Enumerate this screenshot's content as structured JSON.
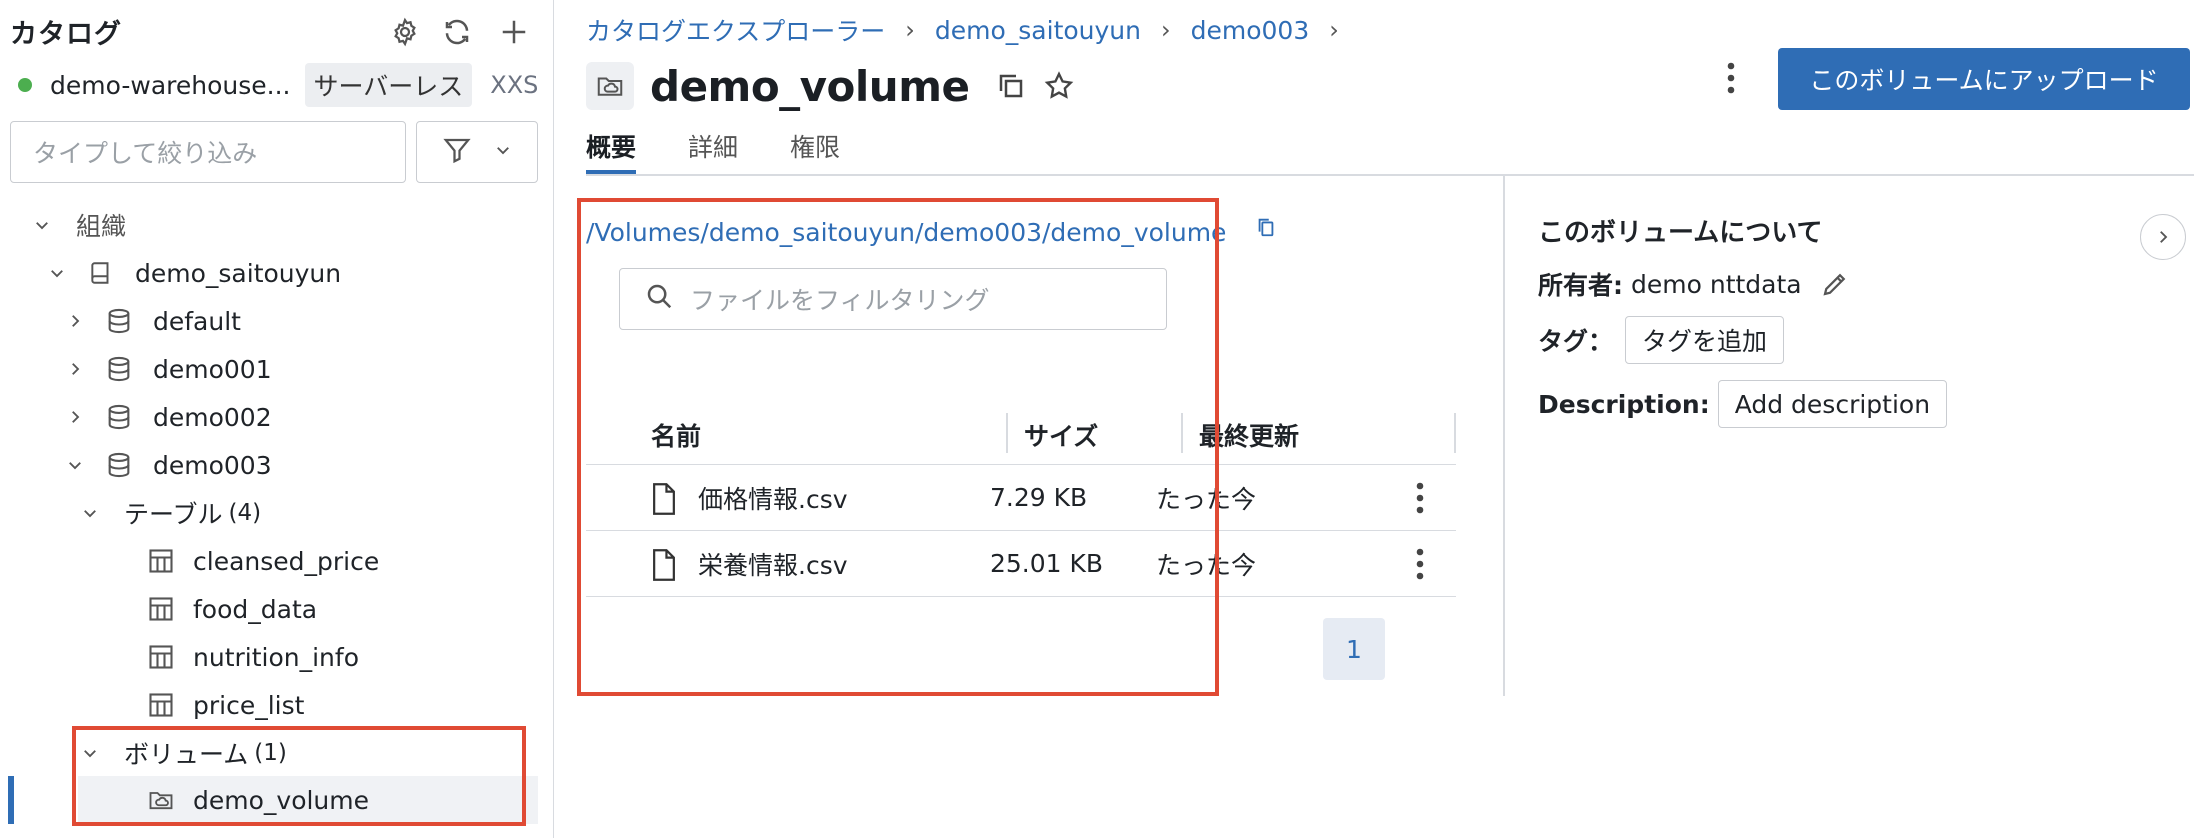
{
  "sidebar": {
    "title": "カタログ",
    "icons": [
      "settings-icon",
      "refresh-icon",
      "plus-icon"
    ],
    "warehouse": {
      "name": "demo-warehouse...",
      "badge": "サーバーレス",
      "size": "XXS",
      "status_color": "#4cae4f"
    },
    "filter_placeholder": "タイプして絞り込み",
    "tree": {
      "org": "組織",
      "catalog": "demo_saitouyun",
      "schemas": [
        "default",
        "demo001",
        "demo002",
        "demo003"
      ],
      "tables_label": "テーブル",
      "tables_count": "(4)",
      "tables": [
        "cleansed_price",
        "food_data",
        "nutrition_info",
        "price_list"
      ],
      "volumes_label": "ボリューム",
      "volumes_count": "(1)",
      "volume": "demo_volume"
    }
  },
  "breadcrumb": {
    "items": [
      "カタログエクスプローラー",
      "demo_saitouyun",
      "demo003"
    ]
  },
  "page": {
    "title": "demo_volume",
    "upload_label": "このボリュームにアップロード",
    "accent": "#2f6db5"
  },
  "tabs": [
    "概要",
    "詳細",
    "権限"
  ],
  "volume_panel": {
    "path": "/Volumes/demo_saitouyun/demo003/demo_volume",
    "filter_placeholder": "ファイルをフィルタリング",
    "columns": {
      "name": "名前",
      "size": "サイズ",
      "modified": "最終更新"
    },
    "rows": [
      {
        "name": "価格情報.csv",
        "size": "7.29 KB",
        "modified": "たった今"
      },
      {
        "name": "栄養情報.csv",
        "size": "25.01 KB",
        "modified": "たった今"
      }
    ],
    "page": "1"
  },
  "about": {
    "title": "このボリュームについて",
    "owner_label": "所有者:",
    "owner": "demo nttdata",
    "tags_label": "タグ：",
    "add_tag": "タグを追加",
    "description_label": "Description:",
    "add_description": "Add description"
  },
  "highlight_color": "#e04a34"
}
